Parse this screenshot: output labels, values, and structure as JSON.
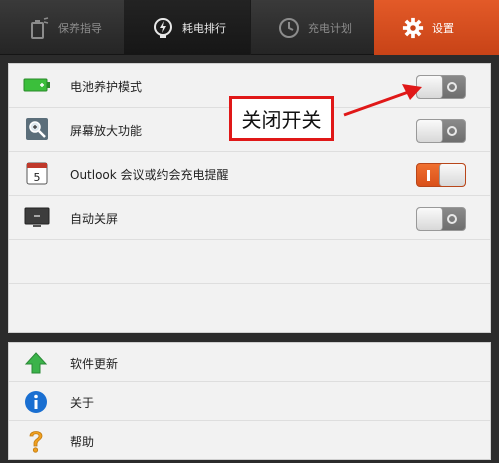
{
  "tabs": [
    {
      "label": "保养指导",
      "icon": "battery-care-icon"
    },
    {
      "label": "耗电排行",
      "icon": "lightning-bulb-icon"
    },
    {
      "label": "充电计划",
      "icon": "clock-icon"
    },
    {
      "label": "设置",
      "icon": "gear-icon"
    }
  ],
  "settings": [
    {
      "label": "电池养护模式",
      "icon": "battery-icon",
      "state": "off"
    },
    {
      "label": "屏幕放大功能",
      "icon": "magnifier-icon",
      "state": "off"
    },
    {
      "label": "Outlook 会议或约会充电提醒",
      "icon": "calendar-icon",
      "state": "on"
    },
    {
      "label": "自动关屏",
      "icon": "monitor-icon",
      "state": "off"
    }
  ],
  "calendar_day": "5",
  "annotation": "关闭开关",
  "bottom": [
    {
      "label": "软件更新",
      "icon": "up-arrow-icon"
    },
    {
      "label": "关于",
      "icon": "info-icon"
    },
    {
      "label": "帮助",
      "icon": "help-icon"
    }
  ],
  "colors": {
    "accent": "#d9501a",
    "annotation_red": "#e01818",
    "update_green": "#3bb34a",
    "info_blue": "#1a6fd1",
    "help_orange": "#f0a020"
  }
}
